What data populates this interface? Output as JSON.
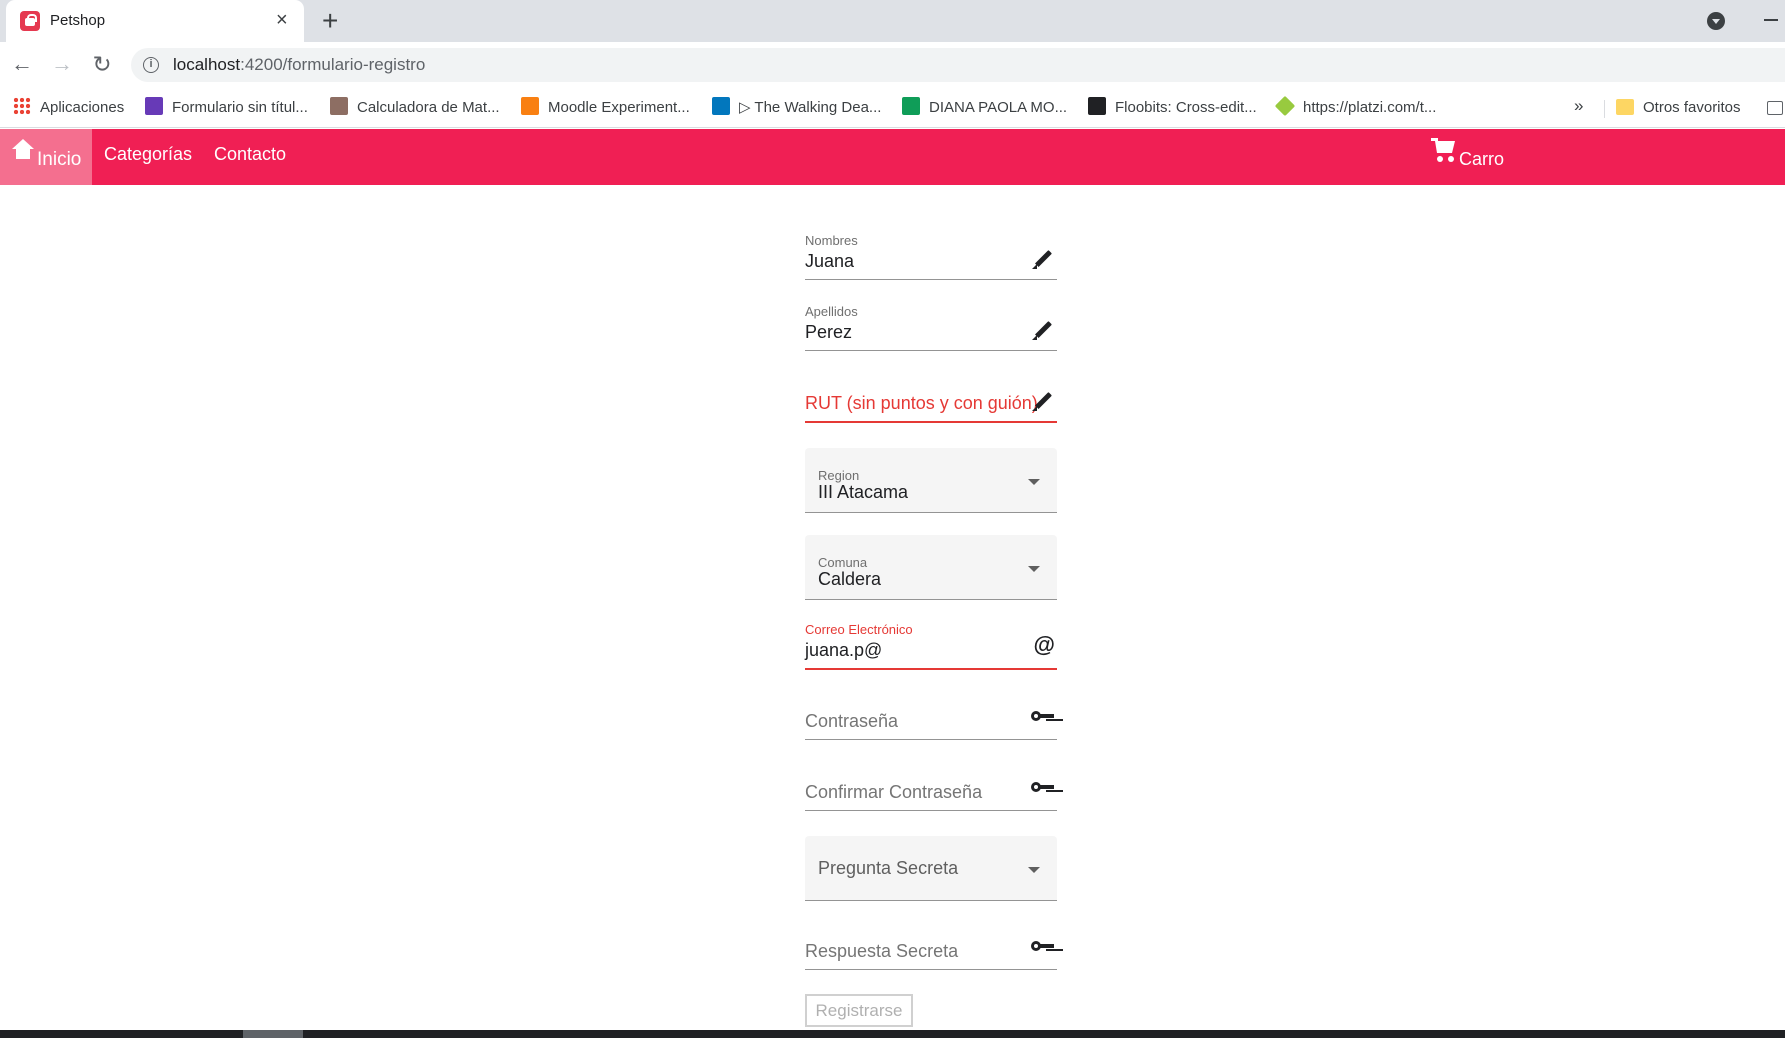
{
  "browser": {
    "tab_title": "Petshop",
    "tab_close": "×",
    "new_tab": "+",
    "url_host": "localhost",
    "url_path": ":4200/formulario-registro",
    "nav_back": "←",
    "nav_forward": "→",
    "nav_reload": "↻"
  },
  "bookmarks": {
    "items": [
      {
        "label": "Aplicaciones",
        "icon": "apps-grid-icon"
      },
      {
        "label": "Formulario sin títul...",
        "icon": "forms-icon",
        "color": "#673ab7"
      },
      {
        "label": "Calculadora de Mat...",
        "icon": "calculator-icon",
        "color": "#8d6e63"
      },
      {
        "label": "Moodle Experiment...",
        "icon": "moodle-icon",
        "color": "#f98012"
      },
      {
        "label": "▷ The Walking Dea...",
        "icon": "video-thumbnail-icon",
        "color": "#0277bd"
      },
      {
        "label": "DIANA PAOLA MO...",
        "icon": "sheets-icon",
        "color": "#0f9d58"
      },
      {
        "label": "Floobits: Cross-edit...",
        "icon": "floobits-icon",
        "color": "#202124"
      },
      {
        "label": "https://platzi.com/t...",
        "icon": "platzi-icon",
        "color": "#98ca3f"
      }
    ],
    "more": "»",
    "other_favorites": "Otros favoritos"
  },
  "navbar": {
    "home": "Inicio",
    "categories": "Categorías",
    "contact": "Contacto",
    "cart": "Carro",
    "color": "#f01f54",
    "active_color": "#f46f8f"
  },
  "form": {
    "nombres": {
      "label": "Nombres",
      "value": "Juana",
      "icon": "pencil-icon"
    },
    "apellidos": {
      "label": "Apellidos",
      "value": "Perez",
      "icon": "pencil-icon"
    },
    "rut": {
      "placeholder": "RUT (sin puntos y con guión)",
      "icon": "pencil-icon",
      "state": "invalid"
    },
    "region": {
      "label": "Region",
      "value": "III Atacama"
    },
    "comuna": {
      "label": "Comuna",
      "value": "Caldera"
    },
    "correo": {
      "label": "Correo Electrónico",
      "value": "juana.p@",
      "icon": "at-icon",
      "state": "invalid"
    },
    "contrasena": {
      "placeholder": "Contraseña",
      "icon": "key-icon"
    },
    "confirmar": {
      "placeholder": "Confirmar Contraseña",
      "icon": "key-icon"
    },
    "pregunta": {
      "placeholder": "Pregunta Secreta"
    },
    "respuesta": {
      "placeholder": "Respuesta Secreta",
      "icon": "key-icon"
    },
    "submit": "Registrarse",
    "error_color": "#e53935"
  }
}
